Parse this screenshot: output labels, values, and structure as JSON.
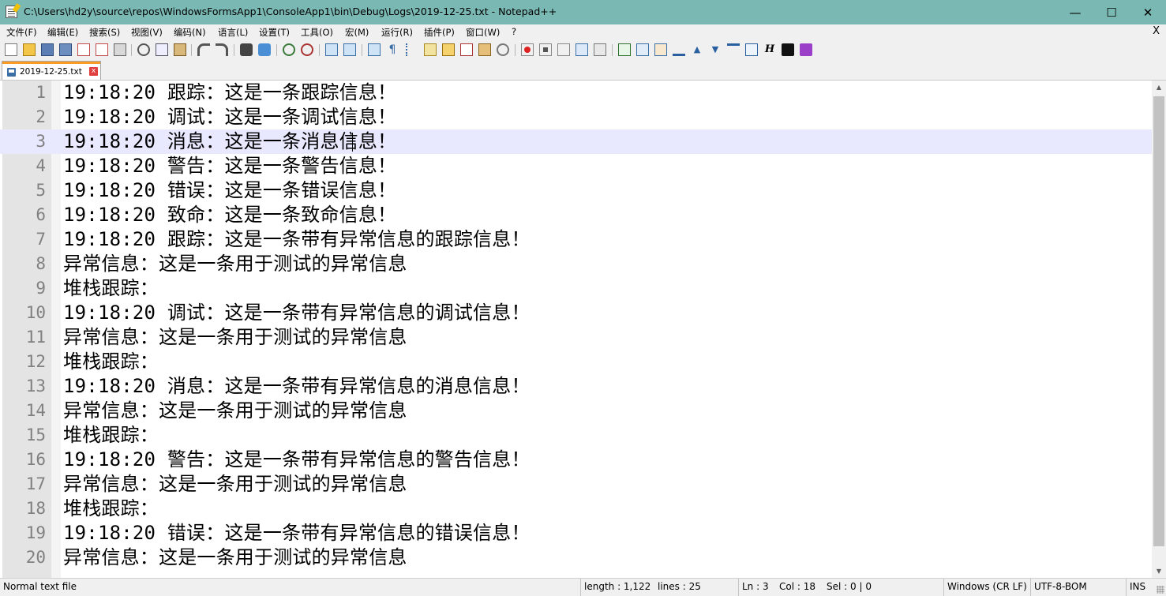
{
  "window": {
    "title": "C:\\Users\\hd2y\\source\\repos\\WindowsFormsApp1\\ConsoleApp1\\bin\\Debug\\Logs\\2019-12-25.txt - Notepad++",
    "minimize_glyph": "—",
    "maximize_glyph": "☐",
    "close_glyph": "✕",
    "titlebar_color": "#7ab8b3"
  },
  "menu": {
    "items": [
      "文件(F)",
      "编辑(E)",
      "搜索(S)",
      "视图(V)",
      "编码(N)",
      "语言(L)",
      "设置(T)",
      "工具(O)",
      "宏(M)",
      "运行(R)",
      "插件(P)",
      "窗口(W)",
      "?"
    ],
    "close_label": "X"
  },
  "toolbar": {
    "icons": [
      "new-file-icon",
      "open-file-icon",
      "save-icon",
      "save-all-icon",
      "close-icon",
      "close-all-icon",
      "print-icon",
      "cut-icon",
      "copy-icon",
      "paste-icon",
      "undo-icon",
      "redo-icon",
      "find-icon",
      "replace-icon",
      "zoom-in-icon",
      "zoom-out-icon",
      "sync-vertical-icon",
      "sync-horizontal-icon",
      "word-wrap-icon",
      "show-all-chars-icon",
      "indent-guide-icon",
      "doc-map-icon",
      "function-list-icon",
      "folder-workspace-icon",
      "monitoring-icon",
      "eye-icon",
      "record-macro-icon",
      "stop-record-icon",
      "play-macro-icon",
      "run-macro-multiple-icon",
      "save-macro-icon",
      "compare-icon",
      "compare-clear-icon",
      "compare-nav-icon",
      "first-diff-icon",
      "prev-diff-icon",
      "next-diff-icon",
      "last-diff-icon",
      "compare-settings-icon",
      "heading-icon",
      "markdown-icon",
      "markdown-preview-icon"
    ]
  },
  "tabs": [
    {
      "label": "2019-12-25.txt",
      "close_glyph": "x",
      "active": true
    }
  ],
  "editor": {
    "current_line": 3,
    "lines": [
      {
        "num": "1",
        "text": "19:18:20 跟踪：这是一条跟踪信息！"
      },
      {
        "num": "2",
        "text": "19:18:20 调试：这是一条调试信息！"
      },
      {
        "num": "3",
        "text": "19:18:20 消息：这是一条消息信息！"
      },
      {
        "num": "4",
        "text": "19:18:20 警告：这是一条警告信息！"
      },
      {
        "num": "5",
        "text": "19:18:20 错误：这是一条错误信息！"
      },
      {
        "num": "6",
        "text": "19:18:20 致命：这是一条致命信息！"
      },
      {
        "num": "7",
        "text": "19:18:20 跟踪：这是一条带有异常信息的跟踪信息！"
      },
      {
        "num": "8",
        "text": "异常信息：这是一条用于测试的异常信息"
      },
      {
        "num": "9",
        "text": "堆栈跟踪："
      },
      {
        "num": "10",
        "text": "19:18:20 调试：这是一条带有异常信息的调试信息！"
      },
      {
        "num": "11",
        "text": "异常信息：这是一条用于测试的异常信息"
      },
      {
        "num": "12",
        "text": "堆栈跟踪："
      },
      {
        "num": "13",
        "text": "19:18:20 消息：这是一条带有异常信息的消息信息！"
      },
      {
        "num": "14",
        "text": "异常信息：这是一条用于测试的异常信息"
      },
      {
        "num": "15",
        "text": "堆栈跟踪："
      },
      {
        "num": "16",
        "text": "19:18:20 警告：这是一条带有异常信息的警告信息！"
      },
      {
        "num": "17",
        "text": "异常信息：这是一条用于测试的异常信息"
      },
      {
        "num": "18",
        "text": "堆栈跟踪："
      },
      {
        "num": "19",
        "text": "19:18:20 错误：这是一条带有异常信息的错误信息！"
      },
      {
        "num": "20",
        "text": "异常信息：这是一条用于测试的异常信息"
      }
    ]
  },
  "scrollbar": {
    "up_glyph": "▲",
    "down_glyph": "▼"
  },
  "statusbar": {
    "file_type": "Normal text file",
    "length": "length : 1,122",
    "lines": "lines : 25",
    "ln": "Ln : 3",
    "col": "Col : 18",
    "sel": "Sel : 0 | 0",
    "eol": "Windows (CR LF)",
    "encoding": "UTF-8-BOM",
    "insert_mode": "INS"
  }
}
